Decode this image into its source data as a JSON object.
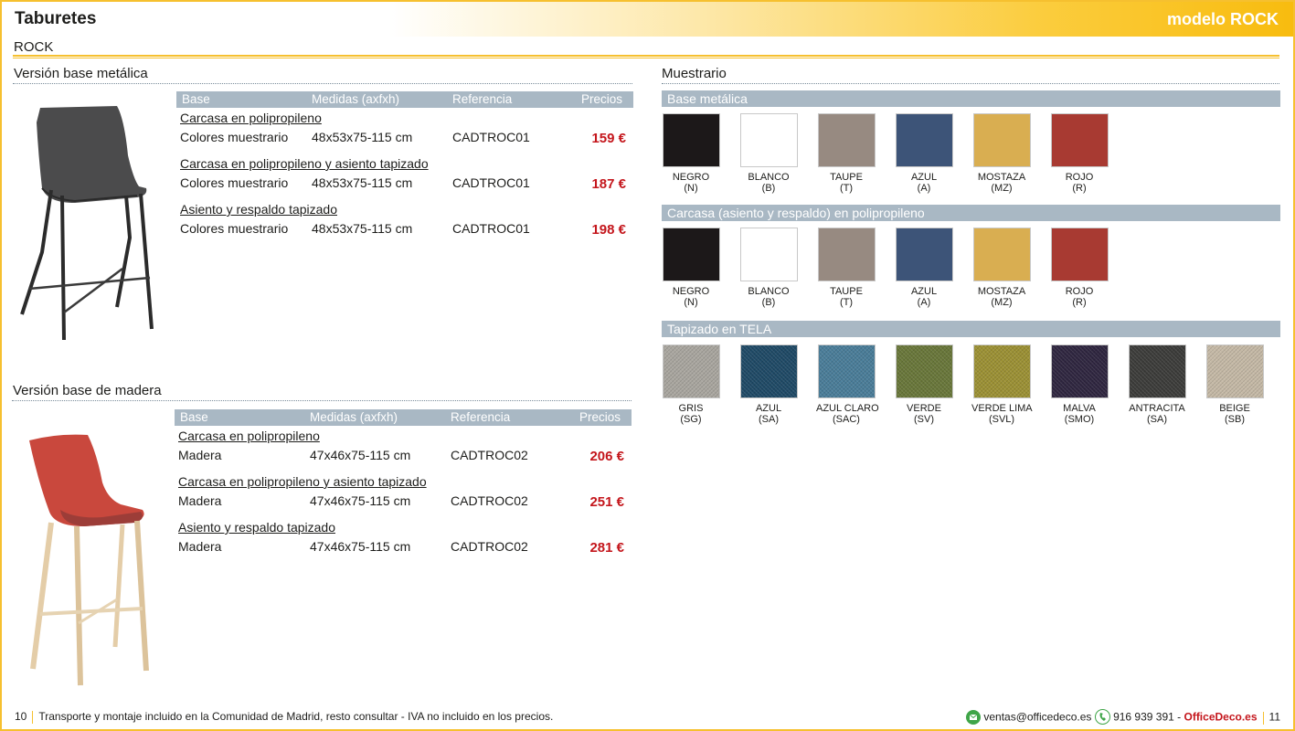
{
  "header": {
    "title": "Taburetes",
    "model": "modelo ROCK"
  },
  "subtitle": "ROCK",
  "metal": {
    "title": "Versión base metálica",
    "columns": [
      "Base",
      "Medidas (axfxh)",
      "Referencia",
      "Precios"
    ],
    "rows": [
      {
        "group": "Carcasa en polipropileno",
        "base": "Colores muestrario",
        "size": "48x53x75-115 cm",
        "ref": "CADTROC01",
        "price": "159 €"
      },
      {
        "group": "Carcasa en polipropileno y asiento tapizado",
        "base": "Colores muestrario",
        "size": "48x53x75-115 cm",
        "ref": "CADTROC01",
        "price": "187 €"
      },
      {
        "group": "Asiento y respaldo tapizado",
        "base": "Colores muestrario",
        "size": "48x53x75-115 cm",
        "ref": "CADTROC01",
        "price": "198 €"
      }
    ]
  },
  "wood": {
    "title": "Versión base de madera",
    "columns": [
      "Base",
      "Medidas (axfxh)",
      "Referencia",
      "Precios"
    ],
    "rows": [
      {
        "group": "Carcasa en polipropileno",
        "base": "Madera",
        "size": "47x46x75-115 cm",
        "ref": "CADTROC02",
        "price": "206 €"
      },
      {
        "group": "Carcasa en polipropileno y asiento tapizado",
        "base": "Madera",
        "size": "47x46x75-115 cm",
        "ref": "CADTROC02",
        "price": "251 €"
      },
      {
        "group": "Asiento y respaldo tapizado",
        "base": "Madera",
        "size": "47x46x75-115 cm",
        "ref": "CADTROC02",
        "price": "281 €"
      }
    ]
  },
  "muestrario": {
    "title": "Muestrario",
    "groups": [
      {
        "label": "Base metálica",
        "swatches": [
          {
            "name": "NEGRO",
            "code": "(N)",
            "color": "#1c1819"
          },
          {
            "name": "BLANCO",
            "code": "(B)",
            "color": "#ffffff"
          },
          {
            "name": "TAUPE",
            "code": "(T)",
            "color": "#978a81"
          },
          {
            "name": "AZUL",
            "code": "(A)",
            "color": "#3d5478"
          },
          {
            "name": "MOSTAZA",
            "code": "(MZ)",
            "color": "#d9ae51"
          },
          {
            "name": "ROJO",
            "code": "(R)",
            "color": "#a83a32"
          }
        ]
      },
      {
        "label": "Carcasa (asiento y respaldo) en polipropileno",
        "swatches": [
          {
            "name": "NEGRO",
            "code": "(N)",
            "color": "#1c1819"
          },
          {
            "name": "BLANCO",
            "code": "(B)",
            "color": "#ffffff"
          },
          {
            "name": "TAUPE",
            "code": "(T)",
            "color": "#978a81"
          },
          {
            "name": "AZUL",
            "code": "(A)",
            "color": "#3d5478"
          },
          {
            "name": "MOSTAZA",
            "code": "(MZ)",
            "color": "#d9ae51"
          },
          {
            "name": "ROJO",
            "code": "(R)",
            "color": "#a83a32"
          }
        ]
      },
      {
        "label": "Tapizado en TELA",
        "fabric": true,
        "swatches": [
          {
            "name": "GRIS",
            "code": "(SG)",
            "color": "#a9a69f"
          },
          {
            "name": "AZUL",
            "code": "(SA)",
            "color": "#1f4a66"
          },
          {
            "name": "AZUL CLARO",
            "code": "(SAC)",
            "color": "#4a7d99"
          },
          {
            "name": "VERDE",
            "code": "(SV)",
            "color": "#69773a"
          },
          {
            "name": "VERDE LIMA",
            "code": "(SVL)",
            "color": "#9c9134"
          },
          {
            "name": "MALVA",
            "code": "(SMO)",
            "color": "#2f2640"
          },
          {
            "name": "ANTRACITA",
            "code": "(SA)",
            "color": "#3c3c3a"
          },
          {
            "name": "BEIGE",
            "code": "(SB)",
            "color": "#c5b9a6"
          }
        ]
      }
    ]
  },
  "footer": {
    "page_left": "10",
    "note": "Transporte y montaje incluido en la Comunidad de Madrid, resto consultar - IVA no incluido en los precios.",
    "email": "ventas@officedeco.es",
    "phone": "916 939 391",
    "dash": "-",
    "brand": "OfficeDeco.es",
    "page_right": "11"
  },
  "colors": {
    "accent": "#f6c02f",
    "price_red": "#c4161c",
    "table_header": "#a9b8c4"
  }
}
